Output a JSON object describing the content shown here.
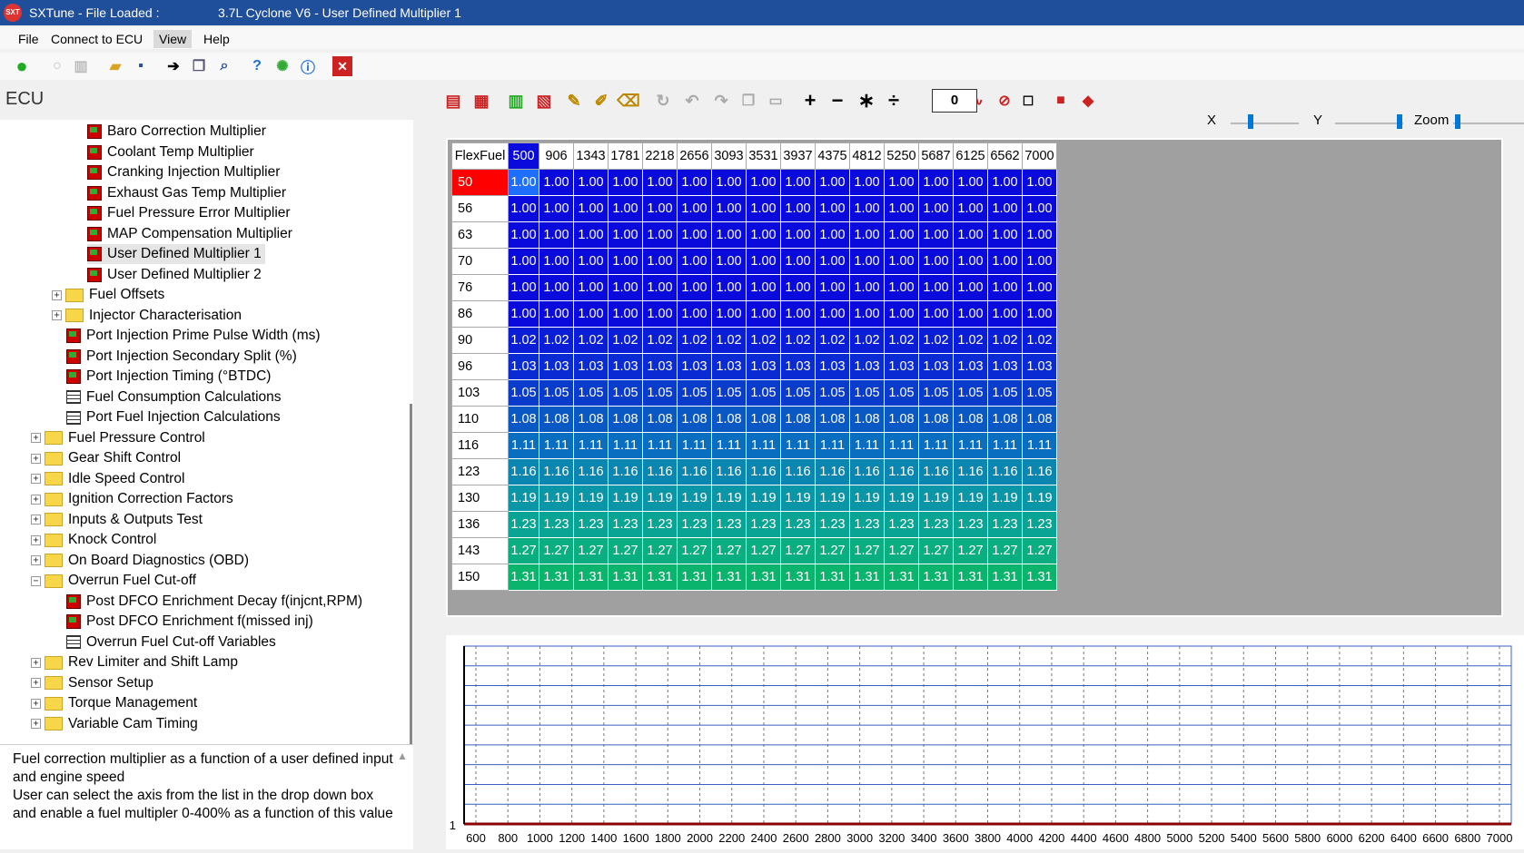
{
  "window": {
    "title_left": "SXTune - File Loaded :",
    "title_right": "3.7L Cyclone V6 - User Defined Multiplier 1"
  },
  "menu": [
    "File",
    "Connect to ECU",
    "View",
    "Help"
  ],
  "ecu": {
    "title": "ECU"
  },
  "tree": [
    {
      "label": "Baro Correction Multiplier",
      "icon": "cube-icon",
      "indent": 3
    },
    {
      "label": "Coolant Temp Multiplier",
      "icon": "cube-icon",
      "indent": 3
    },
    {
      "label": "Cranking Injection Multiplier",
      "icon": "cube-icon",
      "indent": 3
    },
    {
      "label": "Exhaust Gas Temp Multiplier",
      "icon": "cube-icon",
      "indent": 3
    },
    {
      "label": "Fuel Pressure Error Multiplier",
      "icon": "cube-icon",
      "indent": 3
    },
    {
      "label": "MAP Compensation Multiplier",
      "icon": "cube-icon",
      "indent": 3
    },
    {
      "label": "User Defined Multiplier 1",
      "icon": "cube-icon",
      "indent": 3,
      "selected": true
    },
    {
      "label": "User Defined Multiplier 2",
      "icon": "cube-icon",
      "indent": 3
    },
    {
      "label": "Fuel Offsets",
      "icon": "folder-icon",
      "indent": 2,
      "expander": "+"
    },
    {
      "label": "Injector Characterisation",
      "icon": "folder-icon",
      "indent": 2,
      "expander": "+"
    },
    {
      "label": "Port Injection Prime Pulse Width (ms)",
      "icon": "cube-icon",
      "indent": 2
    },
    {
      "label": "Port Injection Secondary Split (%)",
      "icon": "cube-icon",
      "indent": 2
    },
    {
      "label": "Port Injection Timing (°BTDC)",
      "icon": "cube-icon",
      "indent": 2
    },
    {
      "label": "Fuel Consumption Calculations",
      "icon": "grid-icon",
      "indent": 2
    },
    {
      "label": "Port Fuel Injection Calculations",
      "icon": "grid-icon",
      "indent": 2
    },
    {
      "label": "Fuel Pressure Control",
      "icon": "folder-icon",
      "indent": 1,
      "expander": "+"
    },
    {
      "label": "Gear Shift Control",
      "icon": "folder-icon",
      "indent": 1,
      "expander": "+"
    },
    {
      "label": "Idle Speed Control",
      "icon": "folder-icon",
      "indent": 1,
      "expander": "+"
    },
    {
      "label": "Ignition Correction Factors",
      "icon": "folder-icon",
      "indent": 1,
      "expander": "+"
    },
    {
      "label": "Inputs & Outputs Test",
      "icon": "folder-icon",
      "indent": 1,
      "expander": "+"
    },
    {
      "label": "Knock Control",
      "icon": "folder-icon",
      "indent": 1,
      "expander": "+"
    },
    {
      "label": "On Board Diagnostics (OBD)",
      "icon": "folder-icon",
      "indent": 1,
      "expander": "+"
    },
    {
      "label": "Overrun Fuel Cut-off",
      "icon": "folder-icon",
      "indent": 1,
      "expander": "-"
    },
    {
      "label": "Post DFCO Enrichment Decay f(injcnt,RPM)",
      "icon": "cube-icon",
      "indent": 2
    },
    {
      "label": "Post DFCO Enrichment f(missed inj)",
      "icon": "cube-icon",
      "indent": 2
    },
    {
      "label": "Overrun Fuel Cut-off Variables",
      "icon": "grid-icon",
      "indent": 2
    },
    {
      "label": "Rev Limiter and Shift Lamp",
      "icon": "folder-icon",
      "indent": 1,
      "expander": "+"
    },
    {
      "label": "Sensor Setup",
      "icon": "folder-icon",
      "indent": 1,
      "expander": "+"
    },
    {
      "label": "Torque Management",
      "icon": "folder-icon",
      "indent": 1,
      "expander": "+"
    },
    {
      "label": "Variable Cam Timing",
      "icon": "folder-icon",
      "indent": 1,
      "expander": "+"
    }
  ],
  "description": "Fuel correction multiplier as a function of a user defined input and engine speed\nUser can select the axis from the list in the drop down box and enable a fuel multipler 0-400% as a function of this value",
  "toolbar": {
    "value_box": "0",
    "x_label": "X",
    "y_label": "Y",
    "zoom_label": "Zoom"
  },
  "table": {
    "corner": "FlexFuel",
    "columns": [
      "500",
      "906",
      "1343",
      "1781",
      "2218",
      "2656",
      "3093",
      "3531",
      "3937",
      "4375",
      "4812",
      "5250",
      "5687",
      "6125",
      "6562",
      "7000"
    ],
    "rows": [
      {
        "label": "50",
        "value": "1.00",
        "color": "#0a0adc"
      },
      {
        "label": "56",
        "value": "1.00",
        "color": "#0a0adc"
      },
      {
        "label": "63",
        "value": "1.00",
        "color": "#0a0adc"
      },
      {
        "label": "70",
        "value": "1.00",
        "color": "#0a0adc"
      },
      {
        "label": "76",
        "value": "1.00",
        "color": "#0a0adc"
      },
      {
        "label": "86",
        "value": "1.00",
        "color": "#0a0adc"
      },
      {
        "label": "90",
        "value": "1.02",
        "color": "#0a1ed8"
      },
      {
        "label": "96",
        "value": "1.03",
        "color": "#0a2ad4"
      },
      {
        "label": "103",
        "value": "1.05",
        "color": "#0a3ccc"
      },
      {
        "label": "110",
        "value": "1.08",
        "color": "#0a58c4"
      },
      {
        "label": "116",
        "value": "1.11",
        "color": "#0a6ec0"
      },
      {
        "label": "123",
        "value": "1.16",
        "color": "#0a86b0"
      },
      {
        "label": "130",
        "value": "1.19",
        "color": "#0a96a6"
      },
      {
        "label": "136",
        "value": "1.23",
        "color": "#0aa494"
      },
      {
        "label": "143",
        "value": "1.27",
        "color": "#0aae80"
      },
      {
        "label": "150",
        "value": "1.31",
        "color": "#0ab46c"
      }
    ]
  },
  "graph": {
    "y_tick": "1",
    "x_ticks": [
      "600",
      "800",
      "1000",
      "1200",
      "1400",
      "1600",
      "1800",
      "2000",
      "2200",
      "2400",
      "2600",
      "2800",
      "3000",
      "3200",
      "3400",
      "3600",
      "3800",
      "4000",
      "4200",
      "4400",
      "4600",
      "4800",
      "5000",
      "5200",
      "5400",
      "5600",
      "5800",
      "6000",
      "6200",
      "6400",
      "6600",
      "6800",
      "7000"
    ]
  },
  "colors": {
    "titlebar": "#1f4e9b",
    "selected_row_header": "#ff0000",
    "selected_cell": "#1e6fff"
  }
}
